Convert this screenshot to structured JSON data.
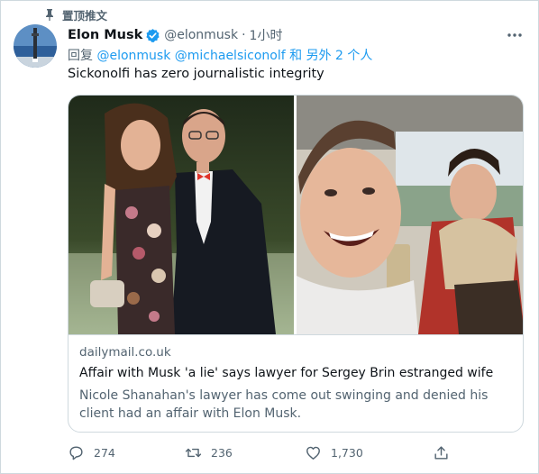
{
  "pinned": {
    "label": "置顶推文"
  },
  "author": {
    "name": "Elon Musk",
    "handle": "@elonmusk",
    "separator": "·",
    "time": "1小时"
  },
  "reply_to": {
    "prefix": "回复",
    "handle1": "@elonmusk",
    "handle2": "@michaelsiconolf",
    "conjunction": "和",
    "others": "另外 2 个人"
  },
  "tweet": {
    "text": "Sickonolfi has zero journalistic integrity"
  },
  "card": {
    "domain": "dailymail.co.uk",
    "title": "Affair with Musk 'a lie' says lawyer for Sergey Brin estranged wife",
    "description": "Nicole Shanahan's lawyer has come out swinging and denied his client had an affair with Elon Musk."
  },
  "actions": {
    "replies": "274",
    "retweets": "236",
    "likes": "1,730"
  },
  "colors": {
    "accent": "#1d9bf0",
    "secondary_text": "#536471",
    "border": "#cfd9de",
    "verified": "#1d9bf0"
  },
  "icons": [
    "pin-icon",
    "verified-badge-icon",
    "more-options-icon",
    "reply-icon",
    "retweet-icon",
    "like-icon",
    "share-icon"
  ]
}
